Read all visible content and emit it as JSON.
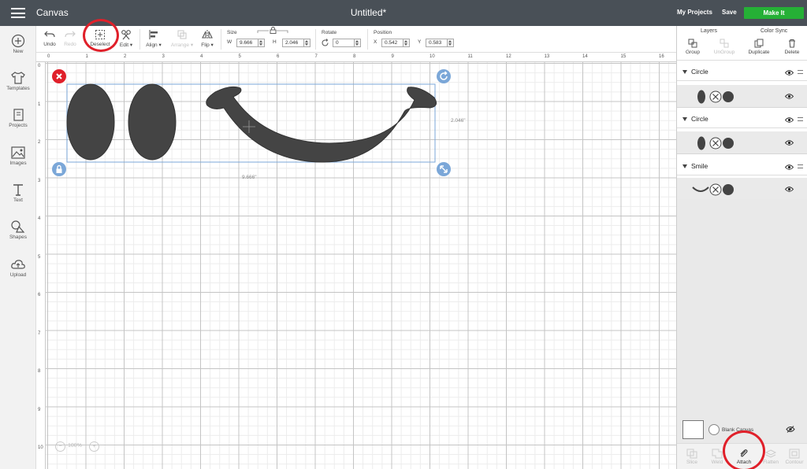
{
  "topbar": {
    "app_title": "Canvas",
    "doc_title": "Untitled*",
    "my_projects": "My Projects",
    "save": "Save",
    "make_it": "Make It",
    "make_it_color": "#25b036"
  },
  "sidebar": {
    "items": [
      {
        "label": "New",
        "icon": "plus-circle-icon"
      },
      {
        "label": "Templates",
        "icon": "tshirt-icon"
      },
      {
        "label": "Projects",
        "icon": "book-icon"
      },
      {
        "label": "Images",
        "icon": "image-icon"
      },
      {
        "label": "Text",
        "icon": "text-t-icon"
      },
      {
        "label": "Shapes",
        "icon": "shapes-icon"
      },
      {
        "label": "Upload",
        "icon": "cloud-upload-icon"
      }
    ]
  },
  "toolbar": {
    "undo": "Undo",
    "redo": "Redo",
    "deselect": "Deselect",
    "edit": "Edit",
    "align": "Align",
    "arrange": "Arrange",
    "flip": "Flip",
    "size_label": "Size",
    "w_label": "W",
    "w_value": "9.666",
    "h_label": "H",
    "h_value": "2.046",
    "rotate_label": "Rotate",
    "rotate_value": "0",
    "position_label": "Position",
    "x_label": "X",
    "x_value": "0.542",
    "y_label": "Y",
    "y_value": "0.583"
  },
  "rulers": {
    "top": [
      "0",
      "1",
      "2",
      "3",
      "4",
      "5",
      "6",
      "7",
      "8",
      "9",
      "10",
      "11",
      "12",
      "13",
      "14",
      "15",
      "16"
    ],
    "left": [
      "0",
      "1",
      "2",
      "3",
      "4",
      "5",
      "6",
      "7",
      "8",
      "9",
      "10"
    ]
  },
  "canvas": {
    "height_dim": "2.046\"",
    "width_dim": "9.666\"",
    "zoom": "100%",
    "shape_color": "#444444",
    "selection_color": "#7ba7d8"
  },
  "panel": {
    "tab_layers": "Layers",
    "tab_color_sync": "Color Sync",
    "actions": [
      {
        "label": "Group",
        "enabled": true
      },
      {
        "label": "UnGroup",
        "enabled": false
      },
      {
        "label": "Duplicate",
        "enabled": true
      },
      {
        "label": "Delete",
        "enabled": true
      }
    ],
    "groups": [
      {
        "name": "Circle",
        "layer_icon": "ellipse-icon"
      },
      {
        "name": "Circle",
        "layer_icon": "ellipse-icon"
      },
      {
        "name": "Smile",
        "layer_icon": "smile-curve-icon"
      }
    ],
    "blank_canvas": "Blank Canvas",
    "bottom_actions": [
      {
        "label": "Slice",
        "active": false
      },
      {
        "label": "Weld",
        "active": false
      },
      {
        "label": "Attach",
        "active": true
      },
      {
        "label": "Flatten",
        "active": false
      },
      {
        "label": "Contour",
        "active": false
      }
    ]
  }
}
